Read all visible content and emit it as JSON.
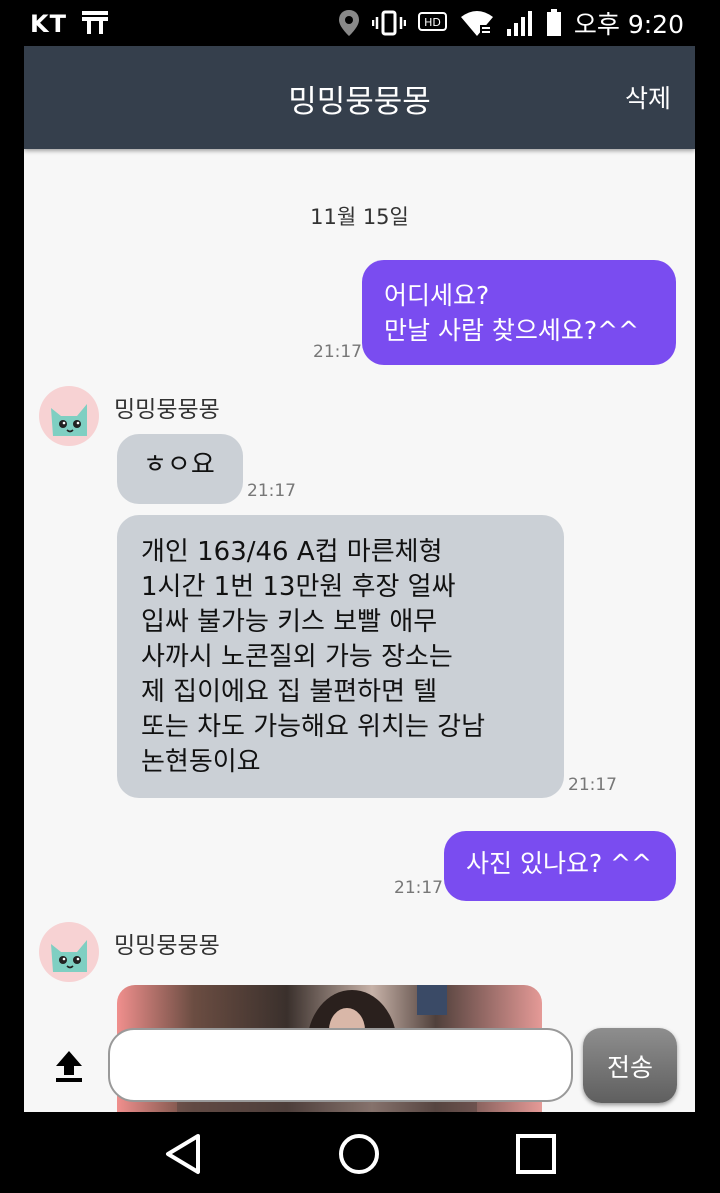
{
  "status_bar": {
    "carrier": "KT",
    "time": "오후 9:20",
    "icons": [
      "kt-logo-icon",
      "location-icon",
      "vibrate-icon",
      "hd-icon",
      "wifi-icon",
      "signal-icon",
      "battery-icon"
    ]
  },
  "header": {
    "title": "밍밍뭉뭉몽",
    "delete_label": "삭제"
  },
  "chat": {
    "date": "11월 15일",
    "messages": [
      {
        "type": "out",
        "lines": [
          "어디세요?",
          "만날 사람 찾으세요?^^"
        ],
        "time": "21:17"
      },
      {
        "type": "in",
        "sender": "밍밍뭉뭉몽",
        "text": "ㅎㅇ요",
        "time": "21:17"
      },
      {
        "type": "in",
        "lines": [
          "개인 163/46 A컵 마른체형",
          "1시간 1번 13만원 후장 얼싸",
          "입싸 불가능 키스 보빨 애무",
          "사까시 노콘질외 가능 장소는",
          "제 집이에요 집 불편하면 텔",
          "또는 차도 가능해요 위치는 강남",
          "논현동이요"
        ],
        "time": "21:17"
      },
      {
        "type": "out",
        "text": "사진 있나요? ^^",
        "time": "21:17"
      },
      {
        "type": "in",
        "sender": "밍밍뭉뭉몽",
        "attachment": "photo"
      }
    ]
  },
  "composer": {
    "input_value": "",
    "send_label": "전송"
  },
  "nav": {
    "icons": [
      "back-icon",
      "home-icon",
      "recents-icon"
    ]
  },
  "colors": {
    "header_bg": "#353f4c",
    "outgoing_bubble": "#7a4cf0",
    "incoming_bubble": "#cbd0d6",
    "chat_bg": "#f7f7f7"
  }
}
